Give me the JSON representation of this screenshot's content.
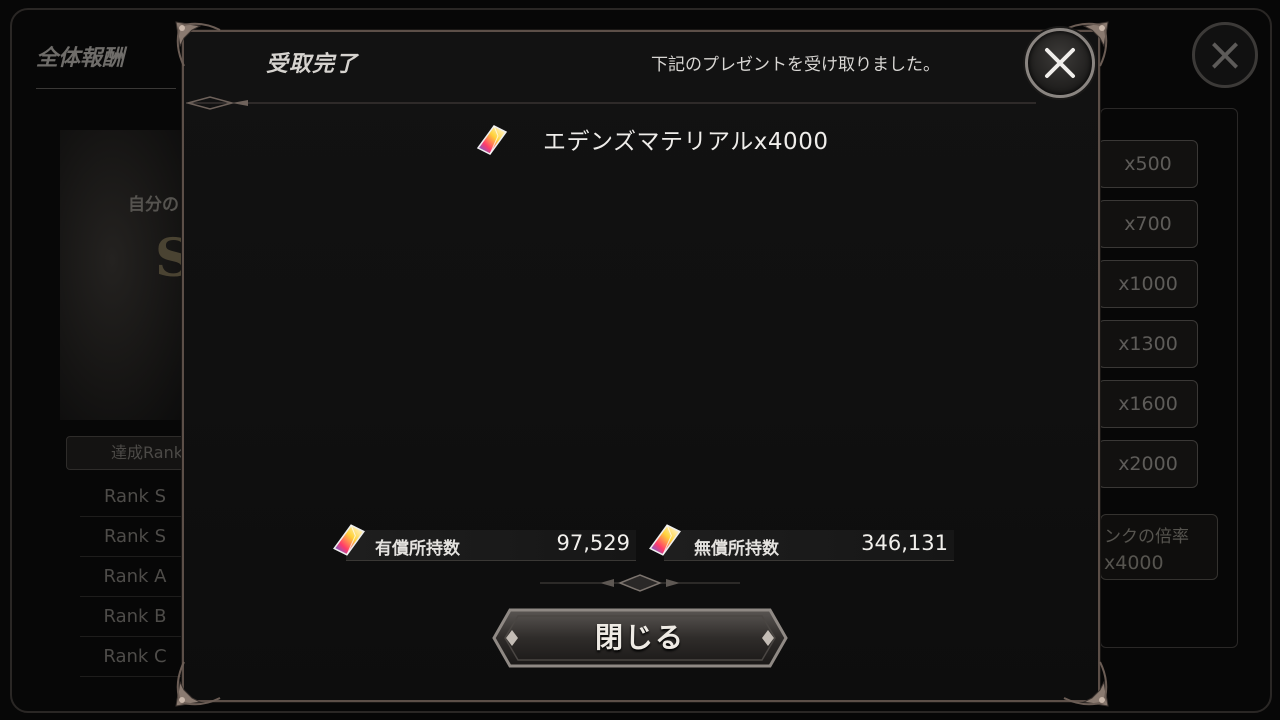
{
  "background": {
    "title": "全体報酬",
    "my_rank_label": "自分のランク",
    "my_rank_value": "SS",
    "rank_tab_header": "達成Rank",
    "rank_rows": [
      "Rank S",
      "Rank S",
      "Rank A",
      "Rank B",
      "Rank C"
    ],
    "reward_buttons": [
      "x500",
      "x700",
      "x1000",
      "x1300",
      "x1600",
      "x2000"
    ],
    "multiplier_label": "ンクの倍率",
    "multiplier_value": "x4000"
  },
  "modal": {
    "title": "受取完了",
    "message": "下記のプレゼントを受け取りました。",
    "reward": {
      "icon": "rainbow-crystal-icon",
      "text": "エデンズマテリアルx4000"
    },
    "paid": {
      "icon": "rainbow-crystal-icon",
      "label": "有償所持数",
      "value": "97,529"
    },
    "free": {
      "icon": "rainbow-crystal-icon",
      "label": "無償所持数",
      "value": "346,131"
    },
    "close_button_label": "閉じる",
    "close_icon": "close-x-icon"
  },
  "colors": {
    "frame_border": "#5c4f48",
    "modal_bg": "#121212",
    "text_primary": "#efedea"
  }
}
